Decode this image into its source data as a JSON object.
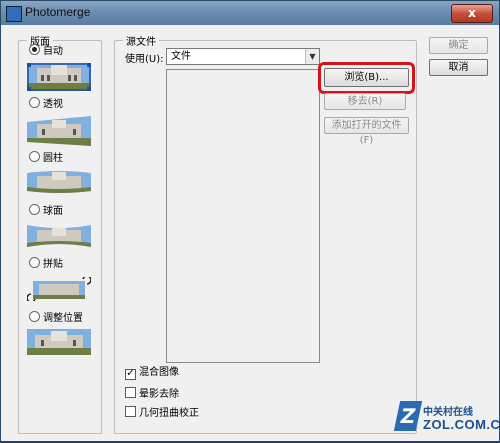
{
  "window": {
    "title": "Photomerge",
    "close_label": "x"
  },
  "layout_group": {
    "title": "版面",
    "options": [
      {
        "label": "自动",
        "selected": true,
        "thumb_icon": "panorama-auto-thumbnail"
      },
      {
        "label": "透视",
        "selected": false,
        "thumb_icon": "panorama-perspective-thumbnail"
      },
      {
        "label": "圆柱",
        "selected": false,
        "thumb_icon": "panorama-cylindrical-thumbnail"
      },
      {
        "label": "球面",
        "selected": false,
        "thumb_icon": "panorama-spherical-thumbnail"
      },
      {
        "label": "拼贴",
        "selected": false,
        "thumb_icon": "panorama-collage-thumbnail"
      },
      {
        "label": "调整位置",
        "selected": false,
        "thumb_icon": "panorama-reposition-thumbnail"
      }
    ]
  },
  "source_group": {
    "title": "源文件",
    "use_label": "使用(U):",
    "use_value": "文件",
    "buttons": {
      "browse": "浏览(B)...",
      "remove": "移去(R)",
      "add_open": "添加打开的文件(F)"
    }
  },
  "checkboxes": [
    {
      "label": "混合图像",
      "checked": true
    },
    {
      "label": "晕影去除",
      "checked": false
    },
    {
      "label": "几何扭曲校正",
      "checked": false
    }
  ],
  "dialog_buttons": {
    "ok": "确定",
    "cancel": "取消"
  },
  "watermark": {
    "cn": "中关村在线",
    "en": "ZOL.COM.CN",
    "letter": "Z"
  },
  "colors": {
    "highlight": "#d4141c",
    "title_bar": "#6f8fb3"
  }
}
